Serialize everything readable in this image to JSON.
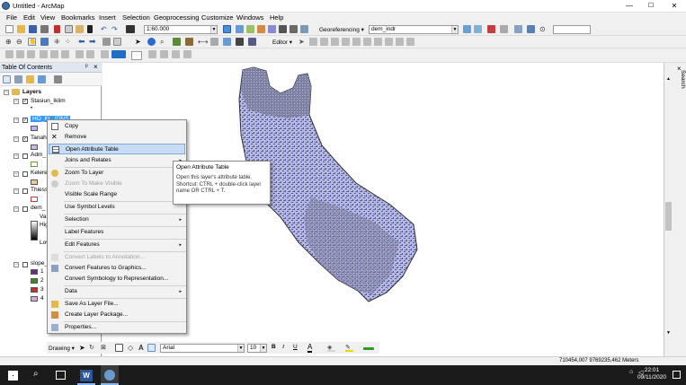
{
  "window": {
    "title": "Untitled - ArcMap",
    "minimize": "—",
    "maximize": "☐",
    "close": "✕"
  },
  "menu": [
    "File",
    "Edit",
    "View",
    "Bookmarks",
    "Insert",
    "Selection",
    "Geoprocessing",
    "Customize",
    "Windows",
    "Help"
  ],
  "toolbar": {
    "scale_value": "1:60.000",
    "georeferencing_label": "Georeferencing ▾",
    "layer_select": "dem_indr",
    "editor_label": "Editor ▾"
  },
  "toc": {
    "title": "Table Of Contents",
    "pin": "ᵖ",
    "close": "×",
    "root": "Layers",
    "layers": [
      {
        "name": "Stasiun_Iklim"
      },
      {
        "name": "HO_KL_IDNS"
      },
      {
        "name": "Tanah"
      },
      {
        "name": "Adm_"
      },
      {
        "name": "Keleren"
      },
      {
        "name": "Thiess"
      },
      {
        "name": "dem_"
      },
      {
        "name": "slope_"
      }
    ],
    "dem_legend": {
      "value_label": "Va",
      "high": "Hig",
      "low": "Low"
    },
    "slope_classes": [
      "1",
      "2",
      "3",
      "4"
    ]
  },
  "context_menu": {
    "items": [
      {
        "label": "Copy",
        "enabled": true,
        "submenu": false,
        "icon": "copy-icon"
      },
      {
        "label": "Remove",
        "enabled": true,
        "submenu": false,
        "icon": "remove-icon"
      },
      {
        "label": "Open Attribute Table",
        "enabled": true,
        "submenu": false,
        "icon": "table-icon",
        "highlighted": true
      },
      {
        "label": "Joins and Relates",
        "enabled": true,
        "submenu": true
      },
      {
        "label": "Zoom To Layer",
        "enabled": true,
        "submenu": false,
        "icon": "zoom-layer-icon"
      },
      {
        "label": "Zoom To Make Visible",
        "enabled": false,
        "submenu": false,
        "icon": "zoom-visible-icon"
      },
      {
        "label": "Visible Scale Range",
        "enabled": true,
        "submenu": false
      },
      {
        "label": "Use Symbol Levels",
        "enabled": true,
        "submenu": false
      },
      {
        "label": "Selection",
        "enabled": true,
        "submenu": true
      },
      {
        "label": "Label Features",
        "enabled": true,
        "submenu": false
      },
      {
        "label": "Edit Features",
        "enabled": true,
        "submenu": true
      },
      {
        "label": "Convert Labels to Annotation...",
        "enabled": false,
        "submenu": false,
        "icon": "convert-labels-icon"
      },
      {
        "label": "Convert Features to Graphics...",
        "enabled": true,
        "submenu": false,
        "icon": "convert-graphics-icon"
      },
      {
        "label": "Convert Symbology to Representation...",
        "enabled": true,
        "submenu": false
      },
      {
        "label": "Data",
        "enabled": true,
        "submenu": true
      },
      {
        "label": "Save As Layer File...",
        "enabled": true,
        "submenu": false,
        "icon": "save-layer-icon"
      },
      {
        "label": "Create Layer Package...",
        "enabled": true,
        "submenu": false,
        "icon": "layer-package-icon"
      },
      {
        "label": "Properties...",
        "enabled": true,
        "submenu": false,
        "icon": "properties-icon"
      }
    ],
    "submenu_arrow": "▸"
  },
  "tooltip": {
    "title": "Open Attribute Table",
    "body": "Open this layer's attribute table. Shortcut: CTRL + double-click layer name OR CTRL + T."
  },
  "right_panel": {
    "search_tab": "Search"
  },
  "drawing": {
    "label": "Drawing ▾",
    "font": "Arial",
    "font_size": "10",
    "bold": "B",
    "italic": "I",
    "underline": "U",
    "font_color": "A"
  },
  "status": {
    "coords": "710454,007  9769235,462 Meters"
  },
  "taskbar": {
    "time": "22:01",
    "date": "09/11/2020"
  },
  "colors": {
    "map_fill": "#b4b8f0",
    "map_texture": "#5a5a6a",
    "selection": "#3399ff"
  }
}
